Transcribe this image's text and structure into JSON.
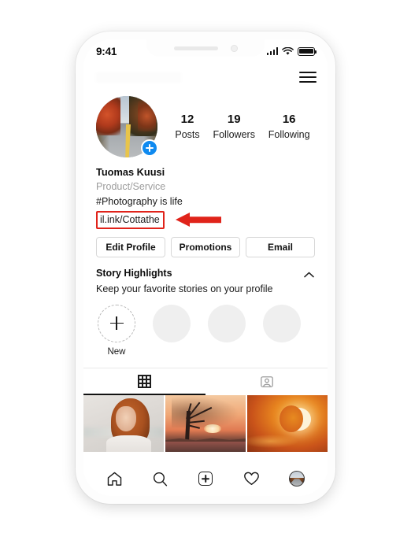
{
  "status_bar": {
    "time": "9:41",
    "signal_icon": "signal-bars-icon",
    "wifi_icon": "wifi-icon",
    "battery_icon": "battery-icon"
  },
  "app_header": {
    "username": "",
    "menu_icon": "hamburger-menu-icon"
  },
  "profile": {
    "avatar_alt": "autumn road profile photo",
    "add_story_icon": "plus-icon",
    "stats": [
      {
        "value": "12",
        "label": "Posts"
      },
      {
        "value": "19",
        "label": "Followers"
      },
      {
        "value": "16",
        "label": "Following"
      }
    ],
    "name": "Tuomas Kuusi",
    "category": "Product/Service",
    "bio": "#Photography is life",
    "link": "il.ink/Cottathe",
    "link_highlight_color": "#e0231a",
    "annotation_arrow": "red-left-arrow"
  },
  "actions": {
    "edit_profile": "Edit Profile",
    "promotions": "Promotions",
    "email": "Email"
  },
  "highlights": {
    "title": "Story Highlights",
    "subtitle": "Keep your favorite stories on your profile",
    "collapse_icon": "chevron-up-icon",
    "new_label": "New",
    "new_icon": "plus-icon",
    "placeholders": 3
  },
  "tabs": [
    {
      "icon": "grid-icon",
      "name": "posts-grid-tab",
      "active": true
    },
    {
      "icon": "tagged-person-icon",
      "name": "tagged-tab",
      "active": false
    }
  ],
  "photo_grid": [
    {
      "alt": "portrait of woman with red hair"
    },
    {
      "alt": "bare tree silhouette at sunset over water"
    },
    {
      "alt": "crescent moon in orange sky"
    }
  ],
  "bottom_nav": [
    {
      "icon": "home-icon",
      "name": "nav-home"
    },
    {
      "icon": "search-icon",
      "name": "nav-search"
    },
    {
      "icon": "add-post-icon",
      "name": "nav-add"
    },
    {
      "icon": "heart-icon",
      "name": "nav-activity"
    },
    {
      "icon": "profile-avatar-icon",
      "name": "nav-profile"
    }
  ]
}
